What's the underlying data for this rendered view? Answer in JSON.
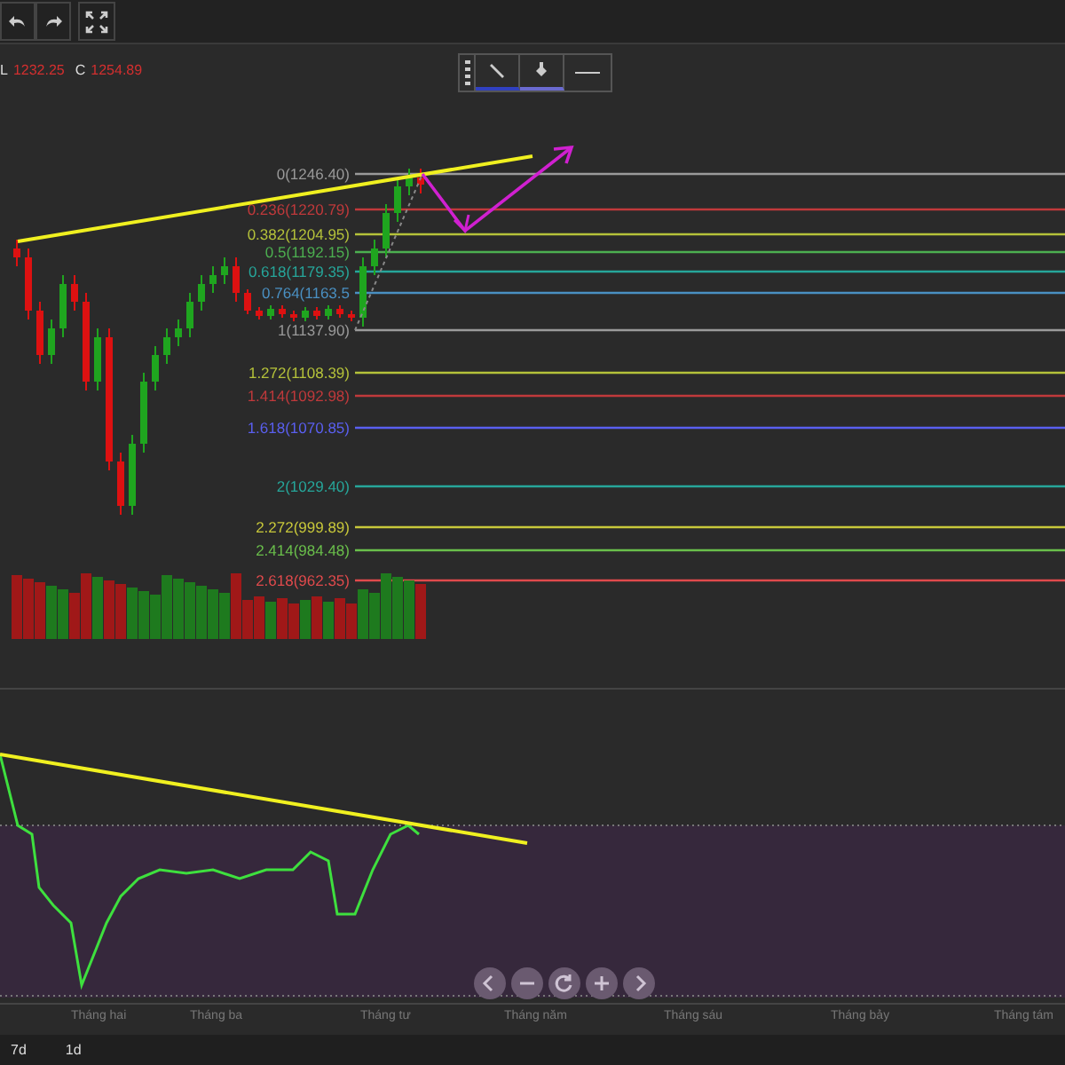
{
  "quote": {
    "low_label": "L",
    "low_value": "1232.25",
    "close_label": "C",
    "close_value": "1254.89"
  },
  "fib_levels": [
    {
      "label": "0(1246.40)",
      "color": "#9a9a9a"
    },
    {
      "label": "0.236(1220.79)",
      "color": "#c0393b"
    },
    {
      "label": "0.382(1204.95)",
      "color": "#b5c23a"
    },
    {
      "label": "0.5(1192.15)",
      "color": "#4caf50"
    },
    {
      "label": "0.618(1179.35)",
      "color": "#26a69a"
    },
    {
      "label": "0.764(1163.5",
      "color": "#4a90c2"
    },
    {
      "label": "1(1137.90)",
      "color": "#9a9a9a"
    },
    {
      "label": "1.272(1108.39)",
      "color": "#b5c23a"
    },
    {
      "label": "1.414(1092.98)",
      "color": "#c0393b"
    },
    {
      "label": "1.618(1070.85)",
      "color": "#5a5ff0"
    },
    {
      "label": "2(1029.40)",
      "color": "#26a69a"
    },
    {
      "label": "2.272(999.89)",
      "color": "#c8c83a"
    },
    {
      "label": "2.414(984.48)",
      "color": "#6abf4b"
    },
    {
      "label": "2.618(962.35)",
      "color": "#e04a4c"
    }
  ],
  "x_axis": [
    "Tháng hai",
    "Tháng ba",
    "Tháng tư",
    "Tháng năm",
    "Tháng sáu",
    "Tháng bảy",
    "Tháng tám"
  ],
  "periods": [
    {
      "label": "7d",
      "selected": false
    },
    {
      "label": "1d",
      "selected": false
    }
  ]
}
